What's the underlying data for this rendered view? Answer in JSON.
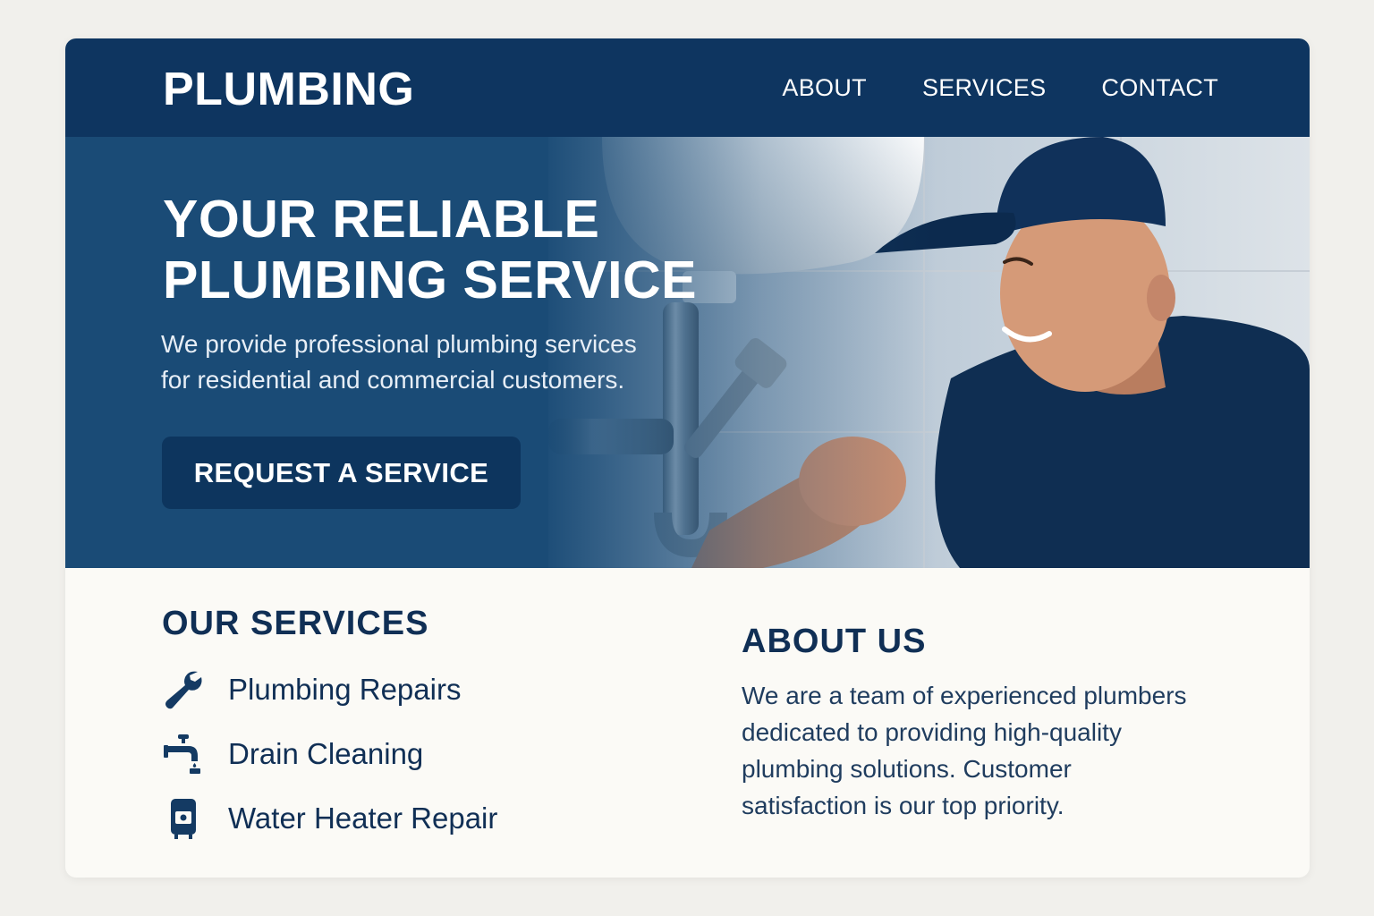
{
  "header": {
    "logo": "PLUMBING",
    "nav": [
      {
        "label": "ABOUT"
      },
      {
        "label": "SERVICES"
      },
      {
        "label": "CONTACT"
      }
    ]
  },
  "hero": {
    "title_line1": "YOUR RELIABLE",
    "title_line2": "PLUMBING SERVICE",
    "subtitle_line1": "We provide professional plumbing services",
    "subtitle_line2": "for residential and commercial customers.",
    "cta_label": "REQUEST A SERVICE",
    "image": "plumber-fixing-sink-pipe-photo"
  },
  "services": {
    "title": "OUR SERVICES",
    "items": [
      {
        "label": "Plumbing Repairs",
        "icon": "wrench-icon"
      },
      {
        "label": "Drain Cleaning",
        "icon": "faucet-icon"
      },
      {
        "label": "Water Heater Repair",
        "icon": "water-heater-icon"
      }
    ]
  },
  "about": {
    "title": "ABOUT US",
    "line1": "We are a team of experienced plumbers",
    "line2": "dedicated to providing high-quality",
    "line3": "plumbing solutions. Customer",
    "line4": "satisfaction is our top priority."
  },
  "colors": {
    "navy": "#0e3560",
    "hero_blue": "#1a4b76",
    "text_dark": "#102f55",
    "page_bg": "#f1f0ec",
    "card_bg": "#fbfaf6"
  }
}
